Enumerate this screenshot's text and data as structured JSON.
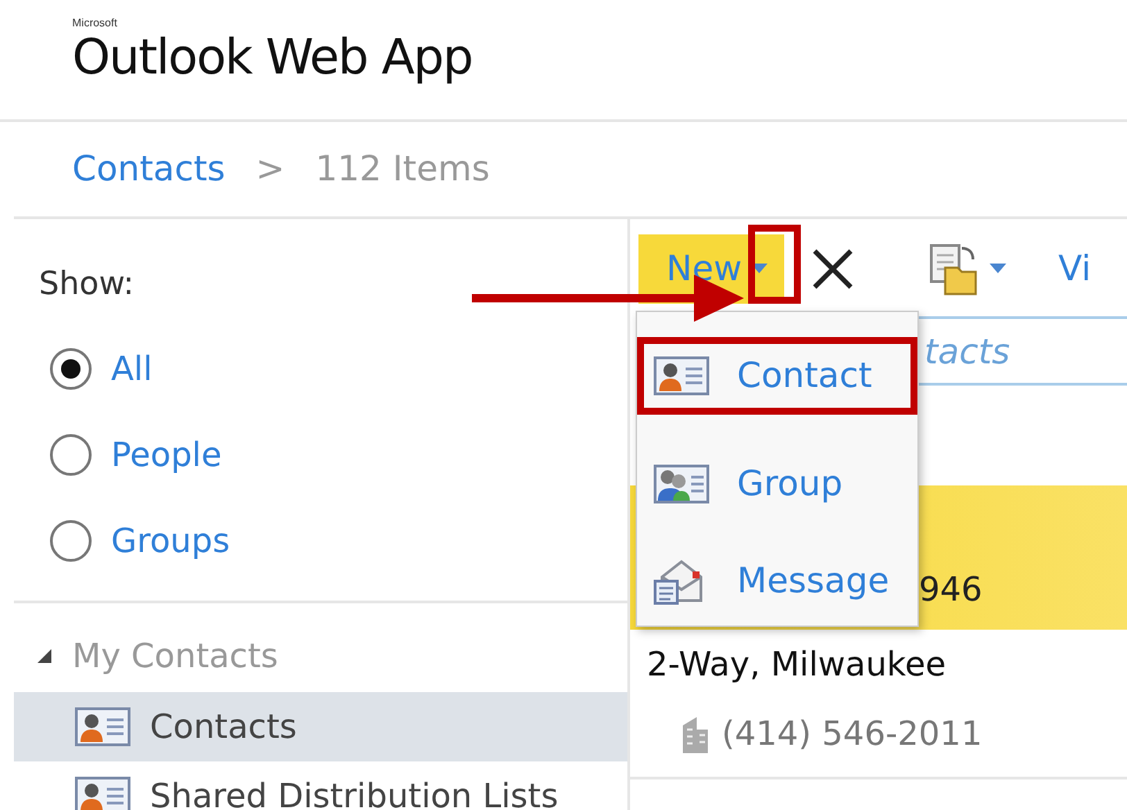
{
  "app": {
    "brand_small": "Microsoft",
    "title": "Outlook Web App"
  },
  "breadcrumb": {
    "folder": "Contacts",
    "separator": ">",
    "count": "112 Items"
  },
  "filter": {
    "label": "Show:",
    "options": [
      {
        "label": "All",
        "selected": true
      },
      {
        "label": "People",
        "selected": false
      },
      {
        "label": "Groups",
        "selected": false
      }
    ]
  },
  "folders": {
    "header": "My Contacts",
    "expanded": true,
    "items": [
      {
        "label": "Contacts",
        "selected": true
      },
      {
        "label": "Shared Distribution Lists",
        "selected": false
      }
    ]
  },
  "toolbar": {
    "new_button": {
      "label": "New",
      "caret_callout": true
    },
    "view_button": "Vi"
  },
  "search": {
    "placeholder": "tacts"
  },
  "contacts": [
    {
      "phone": "946",
      "selected": true
    },
    {
      "name": "2-Way, Milwaukee",
      "phone": "(414) 546-2011",
      "selected": false
    }
  ],
  "new_menu": {
    "open": true,
    "items": [
      {
        "label": "Contact",
        "kind": "contact",
        "callout": true
      },
      {
        "label": "Group",
        "kind": "group",
        "callout": false
      },
      {
        "label": "Message",
        "kind": "message",
        "callout": false
      }
    ]
  }
}
